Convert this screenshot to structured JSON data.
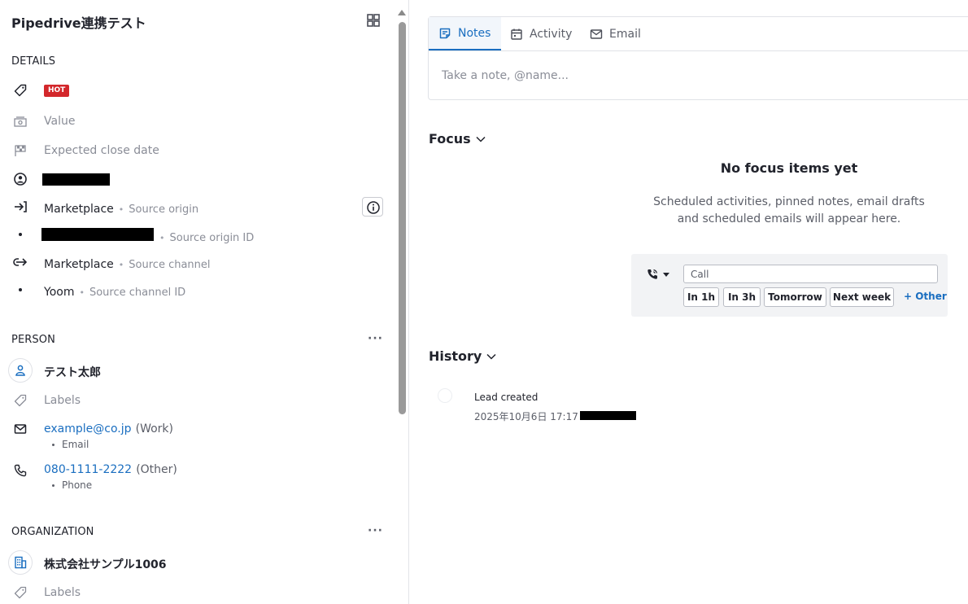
{
  "lead": {
    "title": "Pipedrive連携テスト"
  },
  "details": {
    "heading": "DETAILS",
    "label_badge": "HOT",
    "value_placeholder": "Value",
    "close_date_placeholder": "Expected close date",
    "source_origin": {
      "value": "Marketplace",
      "label": "Source origin"
    },
    "source_origin_id": {
      "label": "Source origin ID"
    },
    "source_channel": {
      "value": "Marketplace",
      "label": "Source channel"
    },
    "source_channel_id": {
      "value": "Yoom",
      "label": "Source channel ID"
    }
  },
  "person": {
    "heading": "PERSON",
    "more": "···",
    "name": "テスト太郎",
    "labels_placeholder": "Labels",
    "email": {
      "value": "example@co.jp",
      "type": "(Work)",
      "label": "Email"
    },
    "phone": {
      "value": "080-1111-2222",
      "type": "(Other)",
      "label": "Phone"
    }
  },
  "organization": {
    "heading": "ORGANIZATION",
    "more": "···",
    "name": "株式会社サンプル1006",
    "labels_placeholder": "Labels"
  },
  "composer": {
    "tabs": [
      {
        "label": "Notes",
        "active": true
      },
      {
        "label": "Activity",
        "active": false
      },
      {
        "label": "Email",
        "active": false
      }
    ],
    "placeholder": "Take a note, @name..."
  },
  "focus": {
    "heading": "Focus",
    "empty_title": "No focus items yet",
    "empty_desc_line1": "Scheduled activities, pinned notes, email drafts",
    "empty_desc_line2": "and scheduled emails will appear here.",
    "quick_add": {
      "input_value": "Call",
      "chips": [
        "In 1h",
        "In 3h",
        "Tomorrow",
        "Next week"
      ],
      "other": "+ Other"
    }
  },
  "history": {
    "heading": "History",
    "items": [
      {
        "title": "Lead created",
        "meta": "2025年10月6日 17:17 ・"
      }
    ]
  },
  "colors": {
    "accent": "#1a6ec0",
    "hot_badge": "#d3272b",
    "muted_text": "#8a8d97"
  }
}
